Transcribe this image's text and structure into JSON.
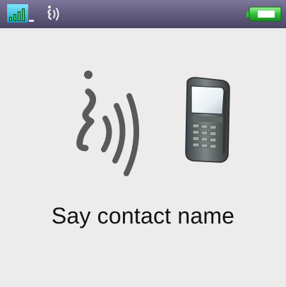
{
  "status_bar": {
    "icons": [
      "signal-strength-icon",
      "voice-command-status-icon",
      "battery-charging-icon"
    ],
    "colors": {
      "background": "#5f597a",
      "signal": "#3cc9e6",
      "battery": "#2fc23a"
    }
  },
  "main": {
    "illustration_icons": [
      "speaking-voice-icon",
      "mobile-phone-icon"
    ],
    "prompt": "Say contact name"
  }
}
